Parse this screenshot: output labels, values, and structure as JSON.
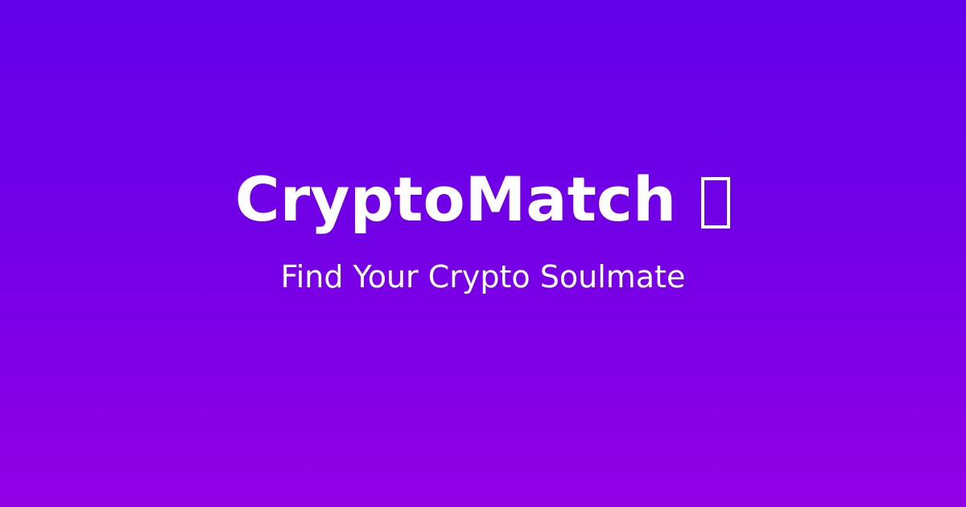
{
  "hero": {
    "title": "CryptoMatch",
    "title_icon": "missing-glyph-icon",
    "subtitle": "Find Your Crypto Soulmate"
  },
  "colors": {
    "background_top": "#6200ea",
    "background_bottom": "#9200e6",
    "text": "#ffffff"
  }
}
